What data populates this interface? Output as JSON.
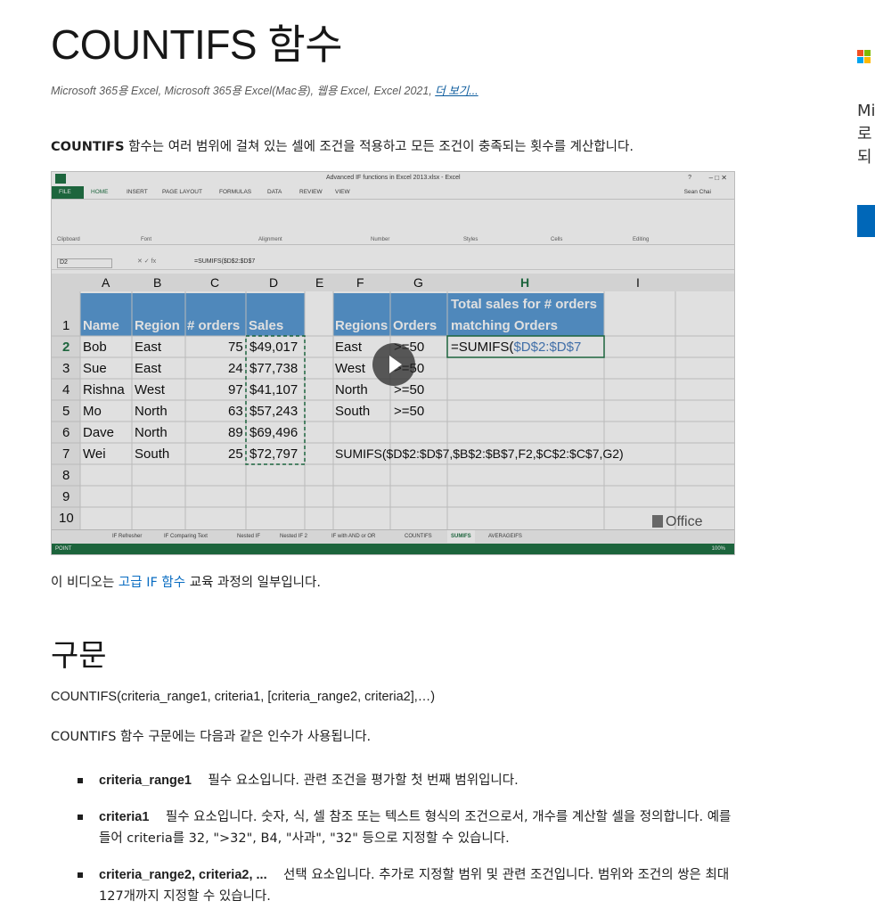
{
  "title": "COUNTIFS 함수",
  "applies_to": "Microsoft 365용 Excel, Microsoft 365용 Excel(Mac용), 웹용 Excel, Excel 2021,",
  "applies_more": "더 보기...",
  "intro_bold": "COUNTIFS",
  "intro_rest": " 함수는 여러 범위에 걸쳐 있는 셀에 조건을 적용하고 모든 조건이 충족되는 횟수를 계산합니다.",
  "video": {
    "window_title": "Advanced IF functions in Excel 2013.xlsx - Excel",
    "user": "Sean Chai",
    "ribbon_tabs": [
      "FILE",
      "HOME",
      "INSERT",
      "PAGE LAYOUT",
      "FORMULAS",
      "DATA",
      "REVIEW",
      "VIEW"
    ],
    "ribbon_groups": [
      "Clipboard",
      "Font",
      "Alignment",
      "Number",
      "Styles",
      "Cells",
      "Editing"
    ],
    "name_box": "D2",
    "formula": "=SUMIFS($D$2:$D$7",
    "col_headers": [
      "A",
      "B",
      "C",
      "D",
      "E",
      "F",
      "G",
      "H",
      "I"
    ],
    "row_headers": [
      "1",
      "2",
      "3",
      "4",
      "5",
      "6",
      "7",
      "8",
      "9",
      "10"
    ],
    "table1_headers": [
      "Name",
      "Region",
      "# orders",
      "Sales"
    ],
    "table1_rows": [
      [
        "Bob",
        "East",
        "75",
        "$49,017"
      ],
      [
        "Sue",
        "East",
        "24",
        "$77,738"
      ],
      [
        "Rishna",
        "West",
        "97",
        "$41,107"
      ],
      [
        "Mo",
        "North",
        "63",
        "$57,243"
      ],
      [
        "Dave",
        "North",
        "89",
        "$69,496"
      ],
      [
        "Wei",
        "South",
        "25",
        "$72,797"
      ]
    ],
    "table2_headers": [
      "Regions",
      "Orders"
    ],
    "h_header_line1": "Total sales for # orders",
    "h_header_line2": "matching Orders",
    "table2_rows": [
      [
        "East",
        ">=50"
      ],
      [
        "West",
        ">=50"
      ],
      [
        "North",
        ">=50"
      ],
      [
        "South",
        ">=50"
      ]
    ],
    "h2_formula_prefix": "=SUMIFS(",
    "h2_formula_ref": "$D$2:$D$7",
    "formula_note": "SUMIFS($D$2:$D$7,$B$2:$B$7,F2,$C$2:$C$7,G2)",
    "sheet_tabs": [
      "IF Refresher",
      "IF Comparing Text",
      "Nested IF",
      "Nested IF 2",
      "IF with AND or OR",
      "COUNTIFS",
      "SUMIFS",
      "AVERAGEIFS"
    ],
    "status": "POINT",
    "zoom": "100%",
    "office_logo": "Office"
  },
  "caption_pre": "이 비디오는 ",
  "caption_link": "고급 IF 함수",
  "caption_post": " 교육 과정의 일부입니다.",
  "syntax_heading": "구문",
  "syntax": "COUNTIFS(criteria_range1, criteria1, [criteria_range2, criteria2],…)",
  "uses": "COUNTIFS 함수 구문에는 다음과 같은 인수가 사용됩니다.",
  "args": [
    {
      "name": "criteria_range1",
      "desc": "    필수 요소입니다. 관련 조건을 평가할 첫 번째 범위입니다."
    },
    {
      "name": "criteria1",
      "desc": "    필수 요소입니다. 숫자, 식, 셀 참조 또는 텍스트 형식의 조건으로서, 개수를 계산할 셀을 정의합니다. 예를 들어 criteria를 32, \">32\", B4, \"사과\", \"32\" 등으로 지정할 수 있습니다."
    },
    {
      "name": "criteria_range2, criteria2, ...",
      "desc": "    선택 요소입니다. 추가로 지정할 범위 및 관련 조건입니다. 범위와 조건의 쌍은 최대 127개까지 지정할 수 있습니다."
    }
  ],
  "side_text": "Mi\n로\n되"
}
